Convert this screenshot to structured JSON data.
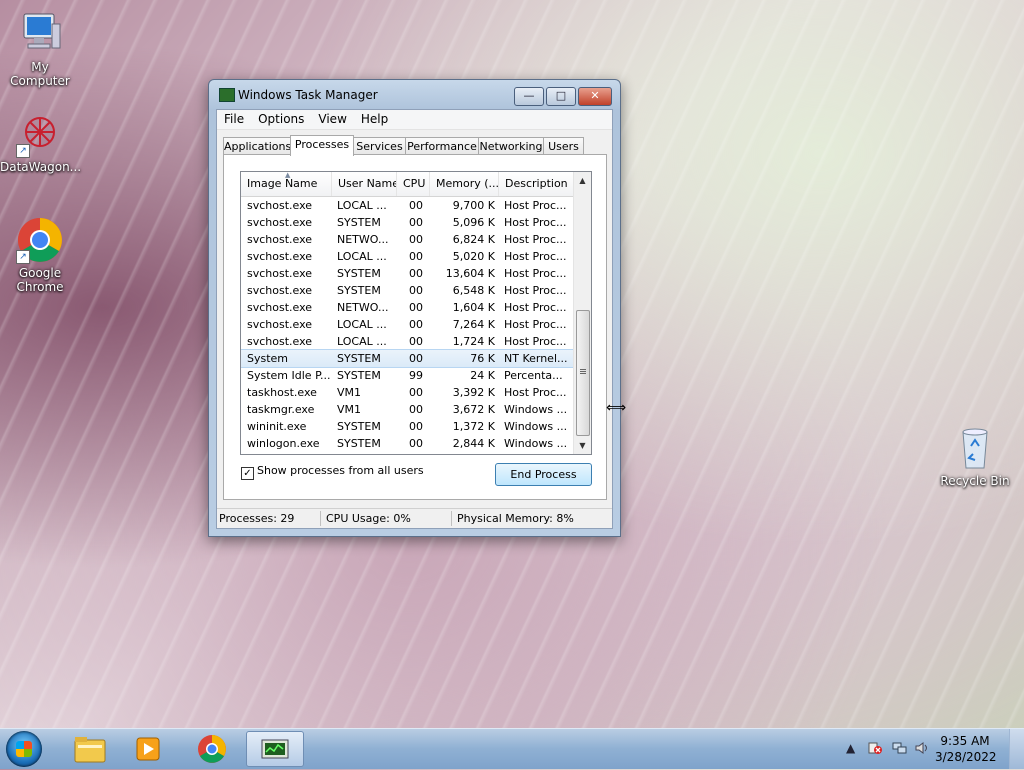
{
  "desktop": {
    "icons": [
      {
        "label": "My Computer"
      },
      {
        "label": "DataWagon..."
      },
      {
        "label": "Google Chrome"
      },
      {
        "label": "Recycle Bin"
      }
    ]
  },
  "window": {
    "title": "Windows Task Manager",
    "controls": {
      "minimize": "—",
      "maximize": "□",
      "close": "✕"
    },
    "menu": [
      "File",
      "Options",
      "View",
      "Help"
    ],
    "tabs": [
      "Applications",
      "Processes",
      "Services",
      "Performance",
      "Networking",
      "Users"
    ],
    "active_tab": "Processes",
    "columns": [
      "Image Name",
      "User Name",
      "CPU",
      "Memory (...",
      "Description"
    ],
    "rows": [
      {
        "image": "svchost.exe",
        "user": "LOCAL ...",
        "cpu": "00",
        "mem": "9,700 K",
        "desc": "Host Proc..."
      },
      {
        "image": "svchost.exe",
        "user": "SYSTEM",
        "cpu": "00",
        "mem": "5,096 K",
        "desc": "Host Proc..."
      },
      {
        "image": "svchost.exe",
        "user": "NETWO...",
        "cpu": "00",
        "mem": "6,824 K",
        "desc": "Host Proc..."
      },
      {
        "image": "svchost.exe",
        "user": "LOCAL ...",
        "cpu": "00",
        "mem": "5,020 K",
        "desc": "Host Proc..."
      },
      {
        "image": "svchost.exe",
        "user": "SYSTEM",
        "cpu": "00",
        "mem": "13,604 K",
        "desc": "Host Proc..."
      },
      {
        "image": "svchost.exe",
        "user": "SYSTEM",
        "cpu": "00",
        "mem": "6,548 K",
        "desc": "Host Proc..."
      },
      {
        "image": "svchost.exe",
        "user": "NETWO...",
        "cpu": "00",
        "mem": "1,604 K",
        "desc": "Host Proc..."
      },
      {
        "image": "svchost.exe",
        "user": "LOCAL ...",
        "cpu": "00",
        "mem": "7,264 K",
        "desc": "Host Proc..."
      },
      {
        "image": "svchost.exe",
        "user": "LOCAL ...",
        "cpu": "00",
        "mem": "1,724 K",
        "desc": "Host Proc..."
      },
      {
        "image": "System",
        "user": "SYSTEM",
        "cpu": "00",
        "mem": "76 K",
        "desc": "NT Kernel..."
      },
      {
        "image": "System Idle P...",
        "user": "SYSTEM",
        "cpu": "99",
        "mem": "24 K",
        "desc": "Percenta..."
      },
      {
        "image": "taskhost.exe",
        "user": "VM1",
        "cpu": "00",
        "mem": "3,392 K",
        "desc": "Host Proc..."
      },
      {
        "image": "taskmgr.exe",
        "user": "VM1",
        "cpu": "00",
        "mem": "3,672 K",
        "desc": "Windows ..."
      },
      {
        "image": "wininit.exe",
        "user": "SYSTEM",
        "cpu": "00",
        "mem": "1,372 K",
        "desc": "Windows ..."
      },
      {
        "image": "winlogon.exe",
        "user": "SYSTEM",
        "cpu": "00",
        "mem": "2,844 K",
        "desc": "Windows ..."
      }
    ],
    "selected_row": "System",
    "show_all_label": "Show processes from all users",
    "show_all_checked": true,
    "end_process_label": "End Process",
    "status": {
      "processes": "Processes: 29",
      "cpu": "CPU Usage: 0%",
      "memory": "Physical Memory: 8%"
    }
  },
  "taskbar": {
    "time": "9:35 AM",
    "date": "3/28/2022"
  }
}
